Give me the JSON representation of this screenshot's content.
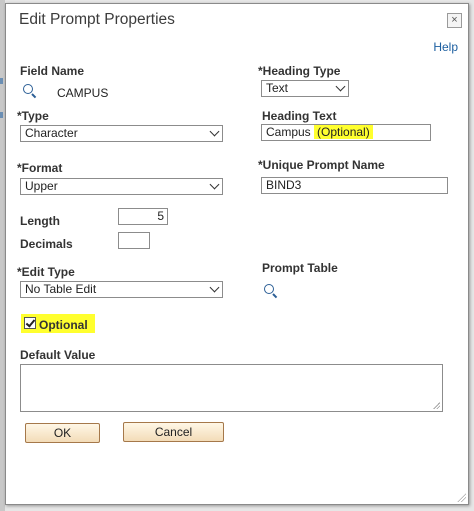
{
  "dialog": {
    "title": "Edit Prompt Properties",
    "help_label": "Help",
    "close_glyph": "×"
  },
  "fields": {
    "field_name_label": "Field Name",
    "field_name_value": "CAMPUS",
    "heading_type_label": "*Heading Type",
    "heading_type_value": "Text",
    "type_label": "*Type",
    "type_value": "Character",
    "heading_text_label": "Heading Text",
    "heading_text_value_plain": "Campus",
    "heading_text_value_highlight": "(Optional)",
    "format_label": "*Format",
    "format_value": "Upper",
    "unique_prompt_label": "*Unique Prompt Name",
    "unique_prompt_value": "BIND3",
    "length_label": "Length",
    "length_value": "5",
    "decimals_label": "Decimals",
    "decimals_value": "",
    "edit_type_label": "*Edit Type",
    "edit_type_value": "No Table Edit",
    "prompt_table_label": "Prompt Table",
    "optional_label": "Optional",
    "optional_checked": true,
    "default_value_label": "Default Value",
    "default_value": ""
  },
  "buttons": {
    "ok_label": "OK",
    "cancel_label": "Cancel"
  },
  "icons": {
    "field_name_lookup": "search-icon",
    "prompt_table_lookup": "search-icon",
    "close": "close-icon"
  },
  "colors": {
    "highlight": "#ffff2e",
    "help_link": "#1d5fa0",
    "button_border": "#a5784a"
  }
}
